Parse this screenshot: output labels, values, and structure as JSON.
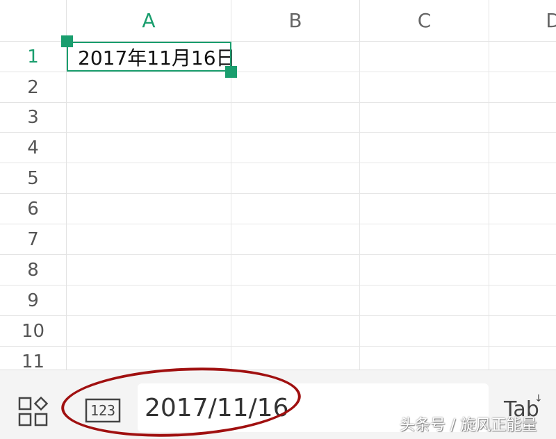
{
  "sheet": {
    "columns": [
      "A",
      "B",
      "C",
      "D"
    ],
    "active_column": "A",
    "rows": [
      "1",
      "2",
      "3",
      "4",
      "5",
      "6",
      "7",
      "8",
      "9",
      "10",
      "11"
    ],
    "active_row": "1",
    "cells": {
      "A1": "2017年11月16日"
    }
  },
  "bottom_bar": {
    "apps_icon": "apps-grid-icon",
    "numeric_keyboard_label": "123",
    "input_value": "2017/11/16",
    "tab_label": "Tab",
    "tab_arrow": "↓"
  },
  "colors": {
    "accent": "#1a9e6e",
    "annotation": "#a01010"
  },
  "watermark": "头条号 / 旋风正能量"
}
